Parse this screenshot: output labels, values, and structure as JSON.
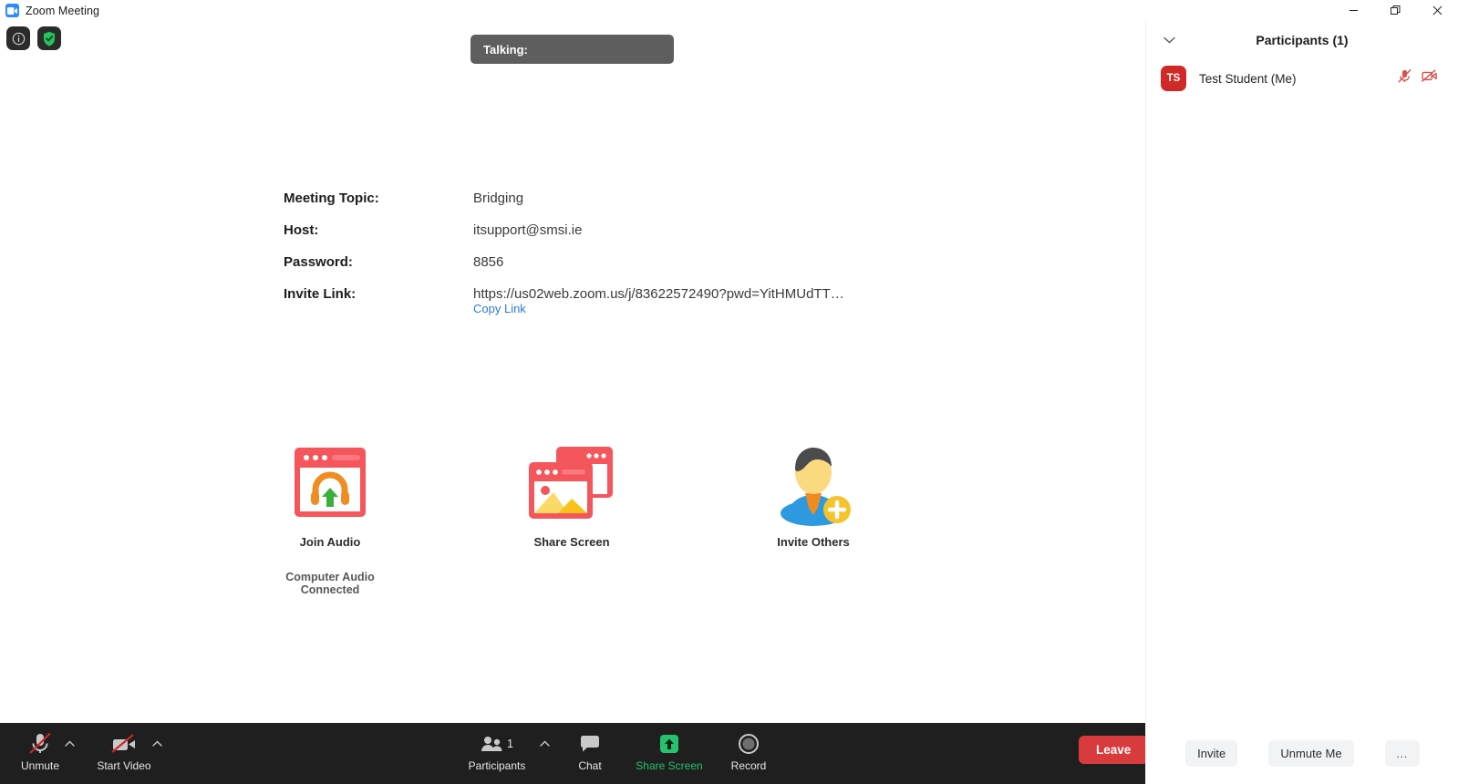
{
  "window": {
    "title": "Zoom Meeting",
    "logo_icon": "zoom-camera-icon",
    "minimize_label": "—",
    "restore_label": "❐",
    "close_label": "✕"
  },
  "overlay": {
    "info_icon": "info-icon",
    "security_icon": "shield-check-icon",
    "talking_label": "Talking:"
  },
  "meeting_info": {
    "rows": [
      {
        "label": "Meeting Topic:",
        "value": "Bridging"
      },
      {
        "label": "Host:",
        "value": "itsupport@smsi.ie"
      },
      {
        "label": "Password:",
        "value": "8856"
      },
      {
        "label": "Invite Link:",
        "value": "https://us02web.zoom.us/j/83622572490?pwd=YitHMUdTT…"
      }
    ],
    "copy_link_label": "Copy Link"
  },
  "tiles": [
    {
      "label": "Join Audio",
      "icon": "join-audio-icon"
    },
    {
      "label": "Share Screen",
      "icon": "share-screen-icon"
    },
    {
      "label": "Invite Others",
      "icon": "invite-others-icon"
    }
  ],
  "audio_status": "Computer Audio Connected",
  "panel": {
    "title": "Participants (1)",
    "collapse_icon": "chevron-down-icon",
    "participants": [
      {
        "initials": "TS",
        "name": "Test Student (Me)",
        "mic_icon": "microphone-muted-icon",
        "video_icon": "video-off-icon",
        "avatar_color": "#cf2a27"
      }
    ],
    "footer": {
      "invite_label": "Invite",
      "unmute_label": "Unmute Me",
      "more_label": "…"
    }
  },
  "toolbar": {
    "mute": {
      "label": "Unmute",
      "icon": "microphone-muted-icon"
    },
    "video": {
      "label": "Start Video",
      "icon": "video-off-icon"
    },
    "participants": {
      "label": "Participants",
      "icon": "participants-icon",
      "count": "1"
    },
    "chat": {
      "label": "Chat",
      "icon": "chat-bubble-icon"
    },
    "share": {
      "label": "Share Screen",
      "icon": "share-arrow-up-icon",
      "color": "#24c26a"
    },
    "record": {
      "label": "Record",
      "icon": "record-circle-icon"
    },
    "leave": {
      "label": "Leave",
      "color": "#d83b3b"
    },
    "caret_icon": "chevron-up-icon"
  }
}
